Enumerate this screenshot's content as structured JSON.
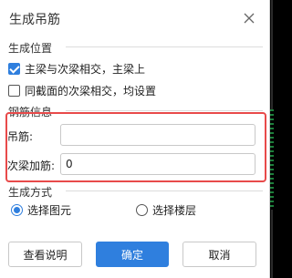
{
  "title": "生成吊筋",
  "sections": {
    "position": "生成位置",
    "rebar_info": "钢筋信息",
    "method": "生成方式"
  },
  "checkboxes": [
    {
      "label": "主梁与次梁相交，主梁上",
      "checked": true
    },
    {
      "label": "同截面的次梁相交，均设置",
      "checked": false
    }
  ],
  "fields": {
    "hanger_label": "吊筋:",
    "hanger_value": "",
    "extra_label": "次梁加筋:",
    "extra_value": "0"
  },
  "radios": [
    {
      "label": "选择图元",
      "selected": true
    },
    {
      "label": "选择楼层",
      "selected": false
    }
  ],
  "buttons": {
    "help": "查看说明",
    "ok": "确定",
    "cancel": "取消"
  },
  "colors": {
    "accent": "#2f7fde",
    "highlight": "#e84a4a"
  }
}
